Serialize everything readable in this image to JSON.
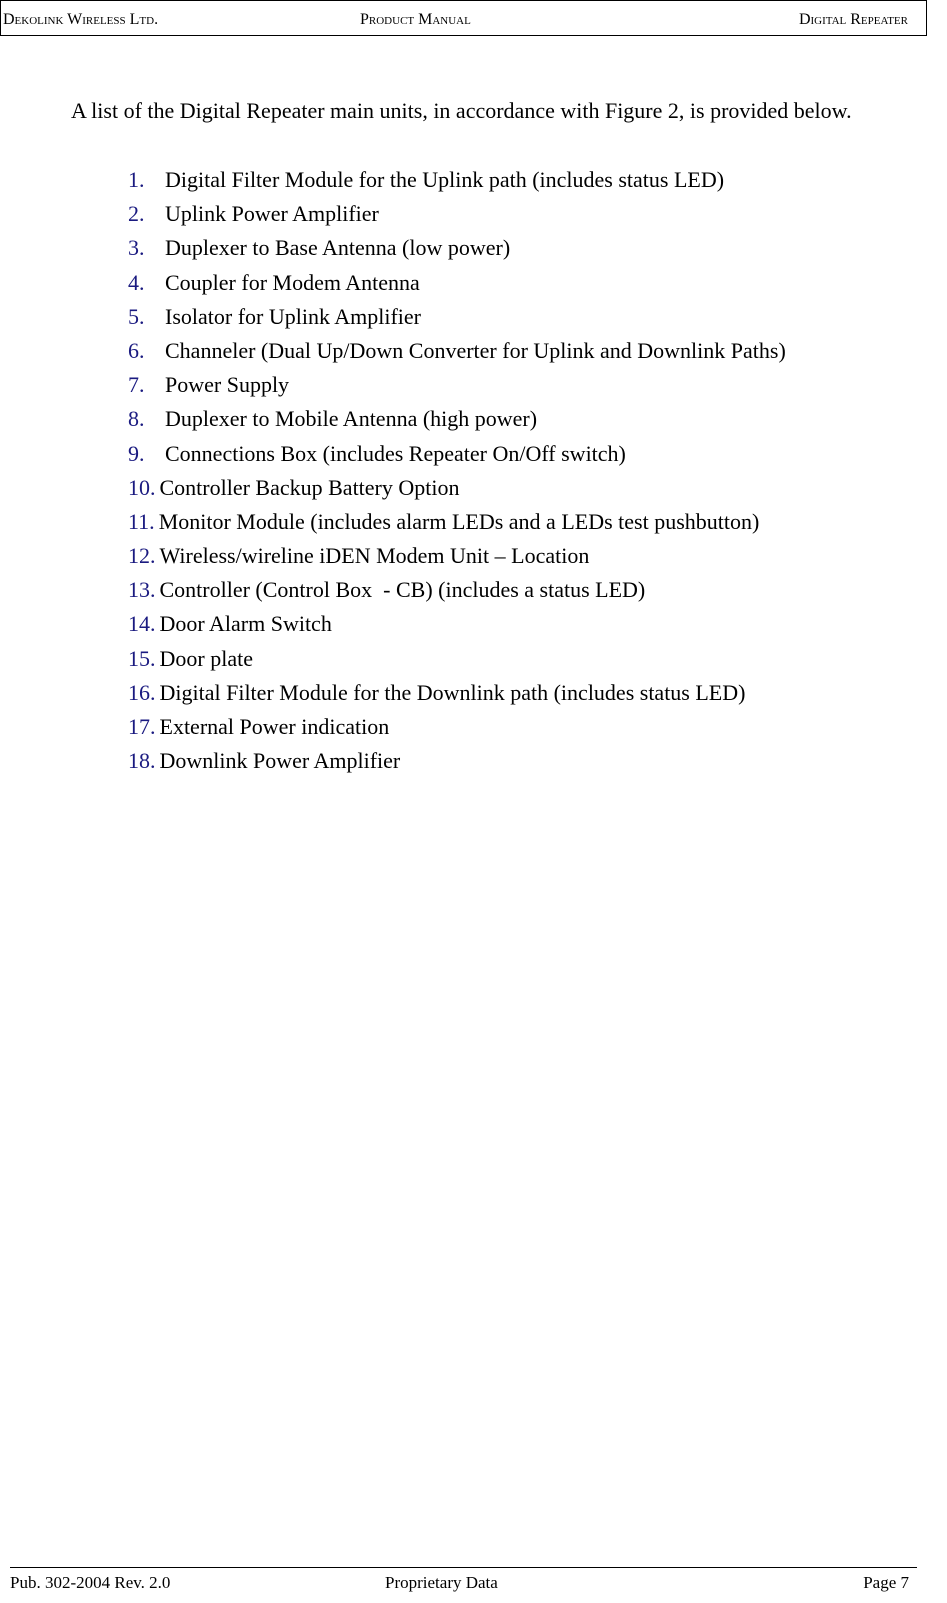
{
  "header": {
    "left": "Dekolink Wireless Ltd.",
    "center": "Product Manual",
    "right": "Digital Repeater"
  },
  "intro": "A list of the Digital Repeater main units, in accordance with Figure 2, is provided below.",
  "units": [
    {
      "num": "1.",
      "text": "Digital Filter Module for the Uplink path (includes status LED)"
    },
    {
      "num": "2.",
      "text": "Uplink Power Amplifier"
    },
    {
      "num": "3.",
      "text": "Duplexer to Base Antenna (low power)"
    },
    {
      "num": "4.",
      "text": "Coupler for Modem Antenna"
    },
    {
      "num": "5.",
      "text": "Isolator for Uplink Amplifier"
    },
    {
      "num": "6.",
      "text": "Channeler (Dual Up/Down Converter for Uplink and Downlink Paths)"
    },
    {
      "num": "7.",
      "text": "Power Supply"
    },
    {
      "num": "8.",
      "text": "Duplexer to Mobile Antenna (high power)"
    },
    {
      "num": "9.",
      "text": "Connections Box (includes Repeater On/Off switch)"
    },
    {
      "num": "10.",
      "text": "Controller Backup Battery Option"
    },
    {
      "num": "11.",
      "text": "Monitor Module (includes alarm LEDs and a LEDs test pushbutton)"
    },
    {
      "num": "12.",
      "text": "Wireless/wireline iDEN Modem Unit – Location"
    },
    {
      "num": "13.",
      "text": "Controller (Control Box  - CB) (includes a status LED)"
    },
    {
      "num": "14.",
      "text": "Door Alarm Switch"
    },
    {
      "num": "15.",
      "text": "Door plate"
    },
    {
      "num": "16.",
      "text": "Digital Filter Module for the Downlink path (includes status LED)"
    },
    {
      "num": "17.",
      "text": "External Power indication"
    },
    {
      "num": "18.",
      "text": "Downlink Power Amplifier"
    }
  ],
  "footer": {
    "left": "Pub. 302-2004 Rev. 2.0",
    "center": "Proprietary Data",
    "right": "Page 7"
  }
}
